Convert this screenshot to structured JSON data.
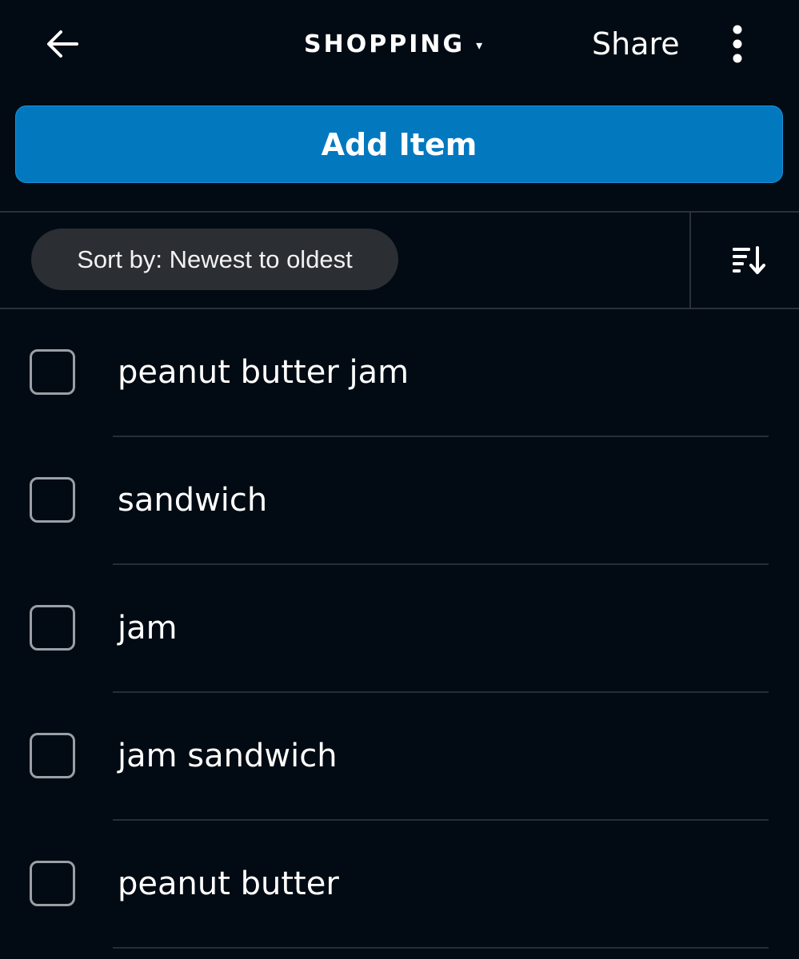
{
  "header": {
    "title": "SHOPPING",
    "title_caret": "▾",
    "share_label": "Share"
  },
  "add_item_label": "Add Item",
  "sort": {
    "label": "Sort by: Newest to oldest"
  },
  "items": [
    {
      "label": "peanut butter jam",
      "checked": false
    },
    {
      "label": "sandwich",
      "checked": false
    },
    {
      "label": "jam",
      "checked": false
    },
    {
      "label": "jam sandwich",
      "checked": false
    },
    {
      "label": "peanut butter",
      "checked": false
    }
  ],
  "colors": {
    "background": "#020b13",
    "accent": "#0278bf",
    "pill": "#2b2e33",
    "checkbox_border": "#9aa0a6"
  },
  "icons": [
    "back-arrow-icon",
    "dropdown-caret-icon",
    "more-vert-icon",
    "sort-descending-icon"
  ]
}
